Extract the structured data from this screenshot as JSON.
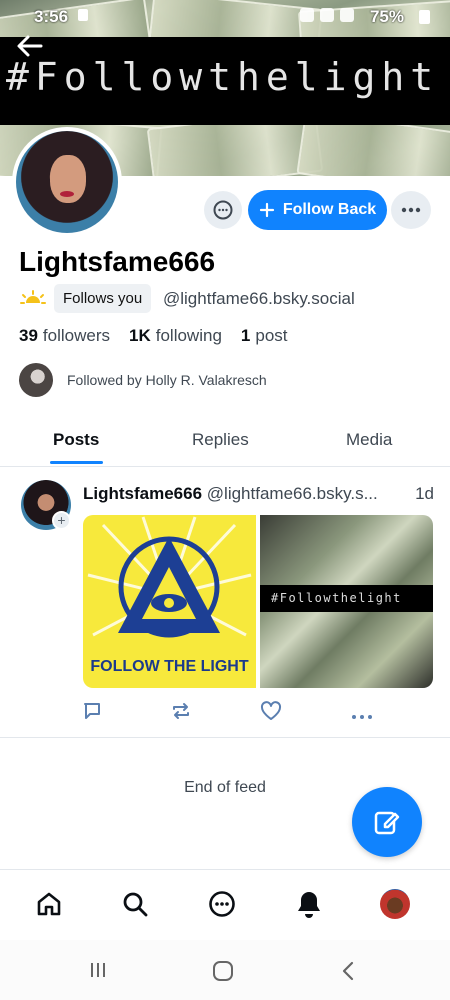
{
  "status_bar": {
    "time": "3:56",
    "battery": "75%"
  },
  "banner": {
    "hashtag": "#Followthelight"
  },
  "profile": {
    "display_name": "Lightsfame666",
    "follows_you": "Follows you",
    "handle": "@lightfame66.bsky.social",
    "followers_count": "39",
    "followers_label": "followers",
    "following_count": "1K",
    "following_label": "following",
    "posts_count": "1",
    "posts_label": "post",
    "followed_by": "Followed by Holly R. Valakresch"
  },
  "actions": {
    "follow_back": "Follow Back"
  },
  "tabs": [
    {
      "label": "Posts",
      "active": true
    },
    {
      "label": "Replies",
      "active": false
    },
    {
      "label": "Media",
      "active": false
    }
  ],
  "post": {
    "author": "Lightsfame666",
    "handle": "@lightfame66.bsky.s...",
    "time": "1d",
    "image1_caption": "FOLLOW THE LIGHT",
    "image2_caption": "#Followthelight"
  },
  "feed": {
    "end_text": "End of feed"
  },
  "colors": {
    "accent": "#1083fe",
    "text_secondary": "#3f4852",
    "divider": "#e3e7ec"
  },
  "icons": [
    "back-arrow-icon",
    "chat-icon",
    "plus-icon",
    "more-icon",
    "sun-icon",
    "reply-icon",
    "repost-icon",
    "like-icon",
    "compose-icon",
    "home-icon",
    "search-icon",
    "messages-icon",
    "bell-icon"
  ]
}
